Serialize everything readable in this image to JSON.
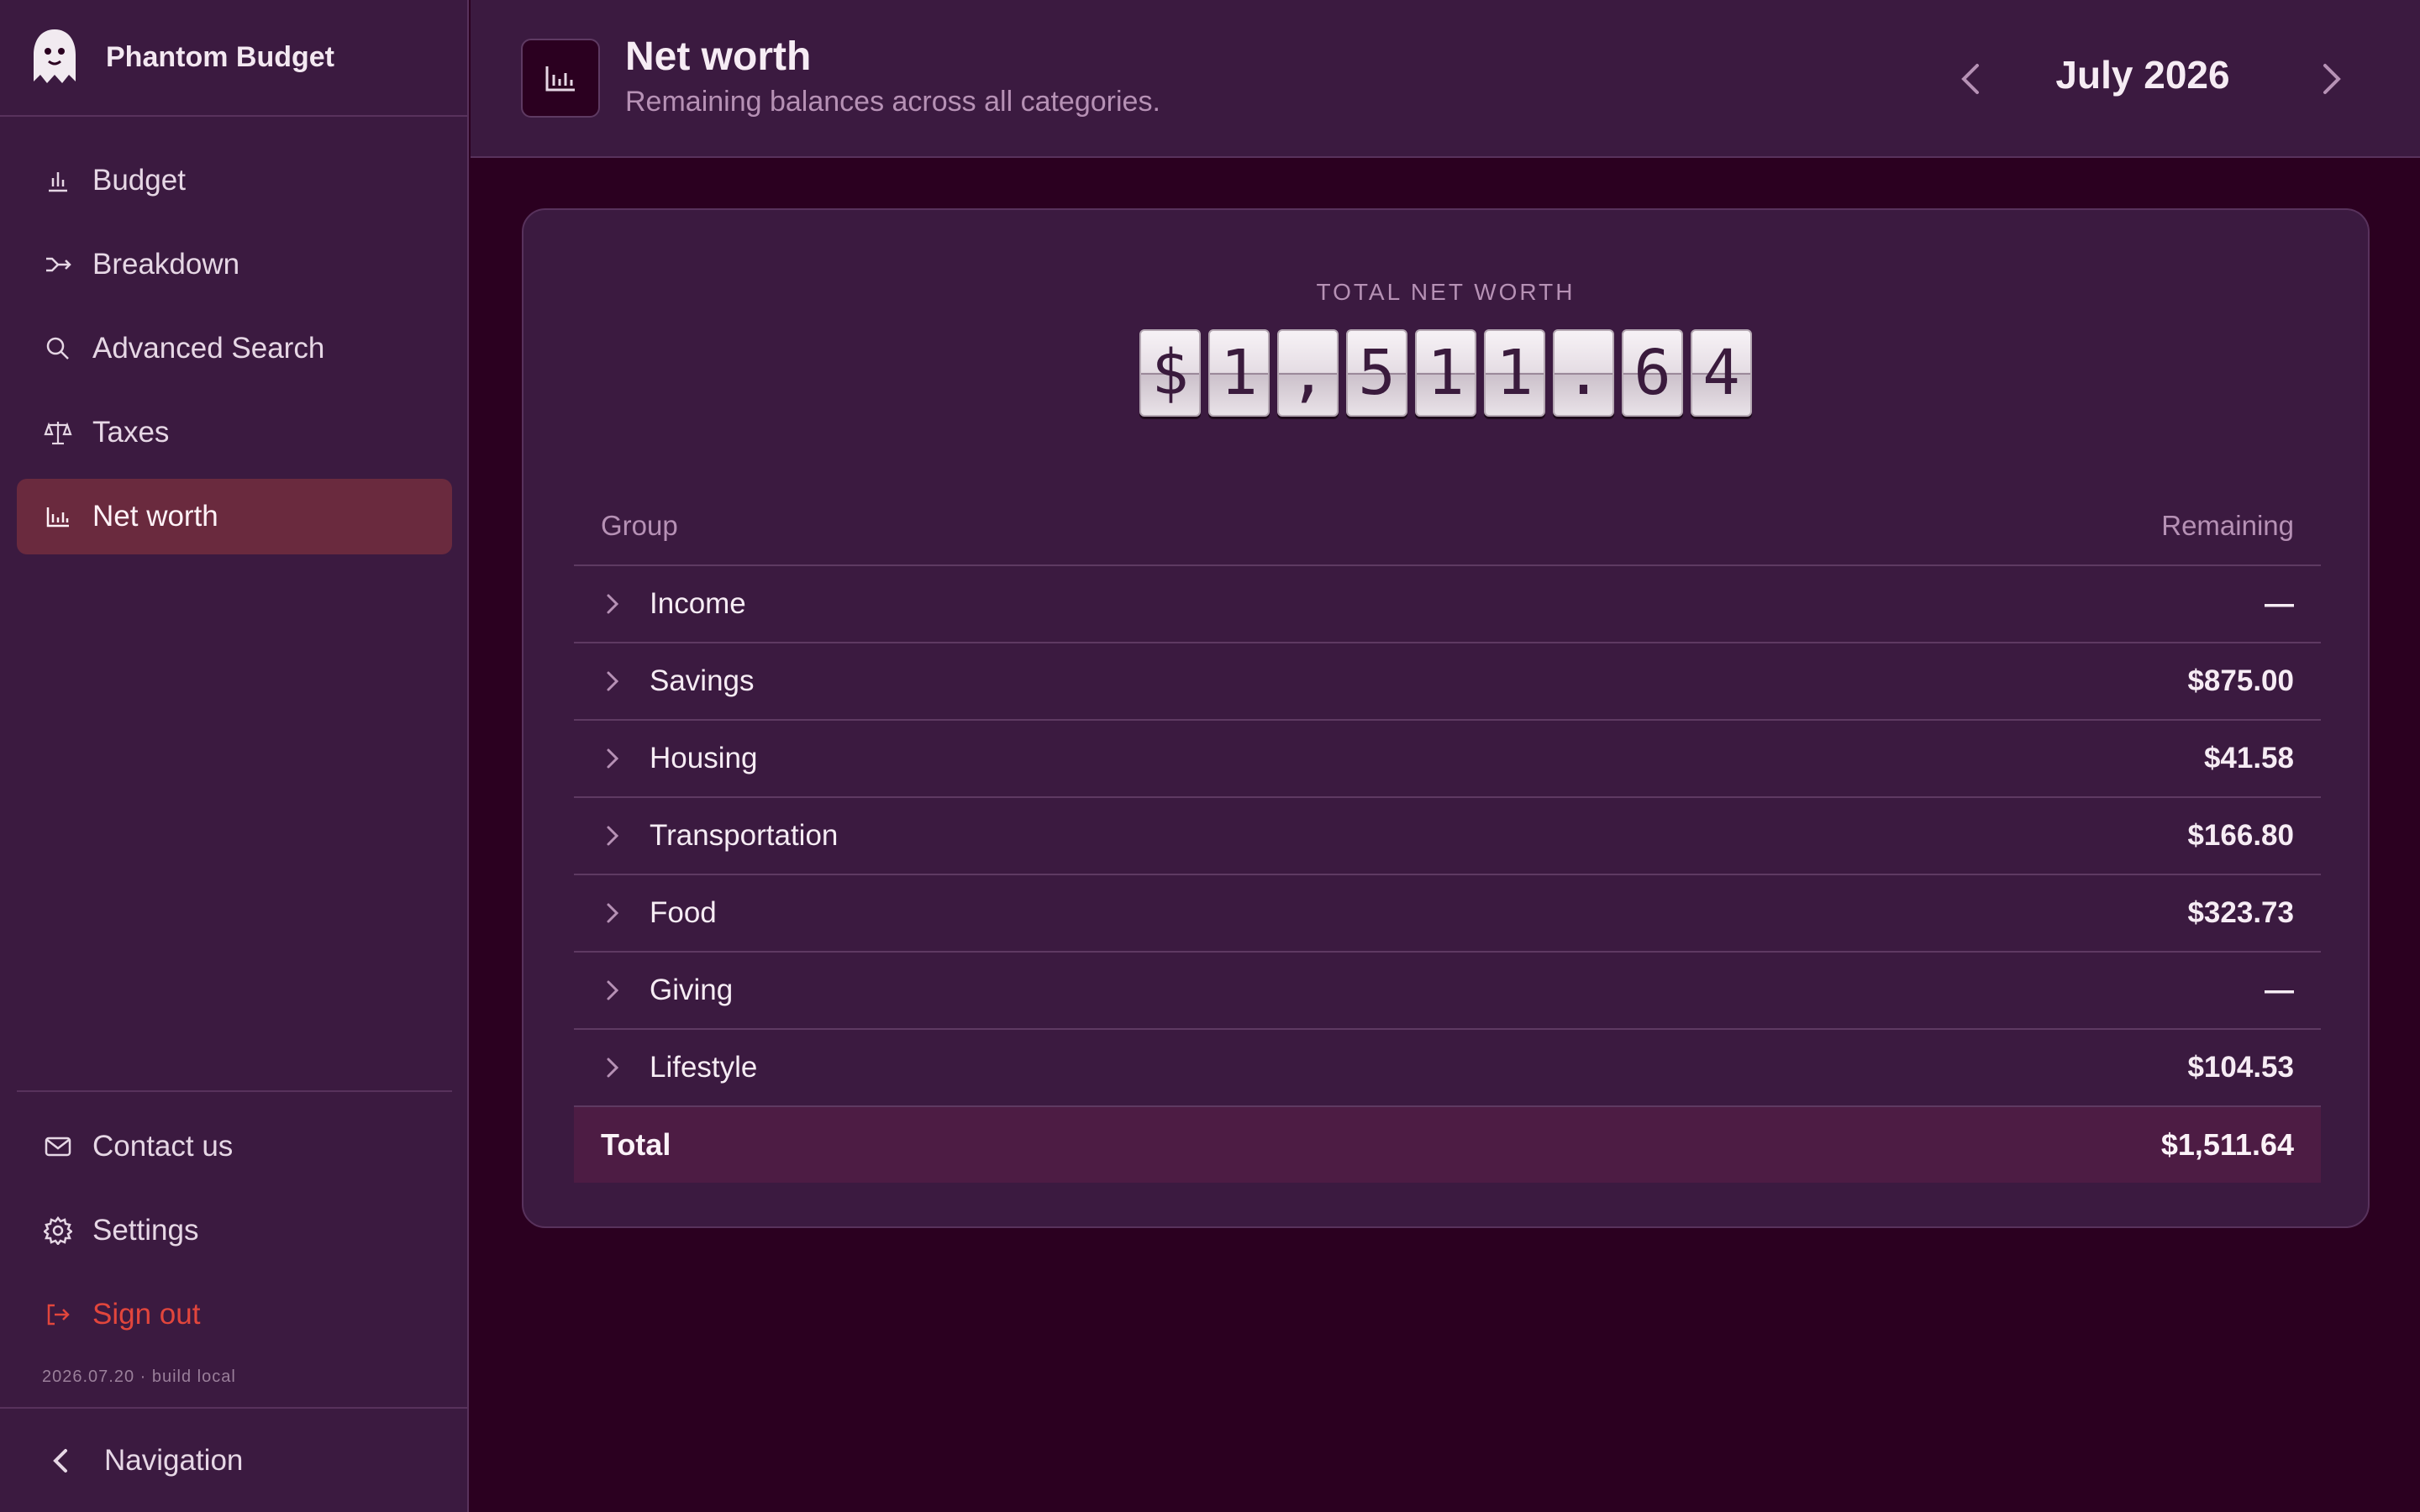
{
  "app": {
    "name": "Phantom Budget",
    "version": "2026.07.20 · build local"
  },
  "sidebar": {
    "items": [
      {
        "label": "Budget",
        "icon": "bar-chart-icon"
      },
      {
        "label": "Breakdown",
        "icon": "split-icon"
      },
      {
        "label": "Advanced Search",
        "icon": "search-icon"
      },
      {
        "label": "Taxes",
        "icon": "scale-icon"
      },
      {
        "label": "Net worth",
        "icon": "chart-icon",
        "active": true
      }
    ],
    "bottom_items": [
      {
        "label": "Contact us",
        "icon": "mail-icon"
      },
      {
        "label": "Settings",
        "icon": "gear-icon"
      },
      {
        "label": "Sign out",
        "icon": "sign-out-icon"
      }
    ],
    "collapse_label": "Navigation"
  },
  "header": {
    "title": "Net worth",
    "subtitle": "Remaining balances across all categories.",
    "month": "July 2026"
  },
  "summary": {
    "caption": "TOTAL NET WORTH",
    "digits": [
      "$",
      "1",
      ",",
      "5",
      "1",
      "1",
      ".",
      "6",
      "4"
    ]
  },
  "table": {
    "columns": {
      "group": "Group",
      "remaining": "Remaining"
    },
    "rows": [
      {
        "group": "Income",
        "remaining": "—"
      },
      {
        "group": "Savings",
        "remaining": "$875.00"
      },
      {
        "group": "Housing",
        "remaining": "$41.58"
      },
      {
        "group": "Transportation",
        "remaining": "$166.80"
      },
      {
        "group": "Food",
        "remaining": "$323.73"
      },
      {
        "group": "Giving",
        "remaining": "—"
      },
      {
        "group": "Lifestyle",
        "remaining": "$104.53"
      }
    ],
    "total_label": "Total",
    "total_value": "$1,511.64"
  },
  "colors": {
    "background": "#2b0020",
    "panel": "#3b1a40",
    "active_nav": "#6a2a3e",
    "danger": "#e2463c",
    "muted": "#b691b5"
  }
}
